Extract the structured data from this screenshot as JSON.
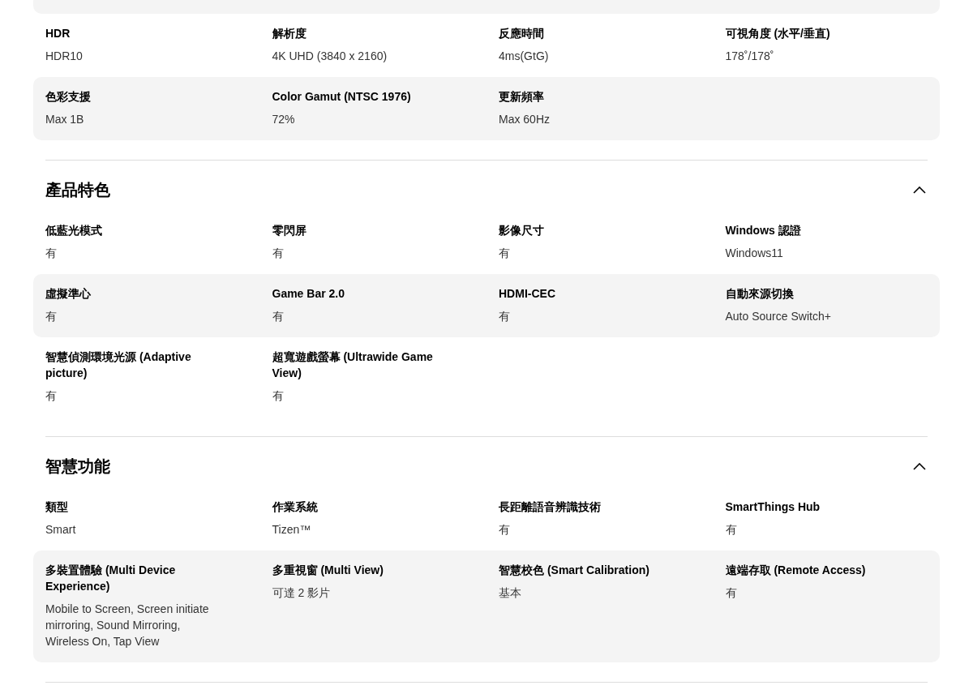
{
  "sections": [
    {
      "rows": [
        [
          {
            "label": "HDR",
            "value": "HDR10"
          },
          {
            "label": "解析度",
            "value": "4K UHD (3840 x 2160)"
          },
          {
            "label": "反應時間",
            "value": "4ms(GtG)"
          },
          {
            "label": "可視角度 (水平/垂直)",
            "value": "178˚/178˚"
          }
        ],
        [
          {
            "label": "色彩支援",
            "value": "Max 1B"
          },
          {
            "label": "Color Gamut (NTSC 1976)",
            "value": "72%"
          },
          {
            "label": "更新頻率",
            "value": "Max 60Hz"
          }
        ]
      ]
    },
    {
      "title": "產品特色",
      "expanded": true,
      "rows": [
        [
          {
            "label": "低藍光模式",
            "value": "有"
          },
          {
            "label": "零閃屏",
            "value": "有"
          },
          {
            "label": "影像尺寸",
            "value": "有"
          },
          {
            "label": "Windows 認證",
            "value": "Windows11"
          }
        ],
        [
          {
            "label": "虛擬準心",
            "value": "有"
          },
          {
            "label": "Game Bar 2.0",
            "value": "有"
          },
          {
            "label": "HDMI-CEC",
            "value": "有"
          },
          {
            "label": "自動來源切換",
            "value": "Auto Source Switch+"
          }
        ],
        [
          {
            "label": "智慧偵測環境光源 (Adaptive picture)",
            "value": "有"
          },
          {
            "label": "超寬遊戲螢幕 (Ultrawide Game View)",
            "value": "有"
          }
        ]
      ]
    },
    {
      "title": "智慧功能",
      "expanded": true,
      "rows": [
        [
          {
            "label": "類型",
            "value": "Smart"
          },
          {
            "label": "作業系統",
            "value": "Tizen™"
          },
          {
            "label": "長距離語音辨識技術",
            "value": "有"
          },
          {
            "label": "SmartThings Hub",
            "value": "有"
          }
        ],
        [
          {
            "label": "多裝置體驗 (Multi Device Experience)",
            "value": "Mobile to Screen, Screen initiate mirroring, Sound Mirroring, Wireless On, Tap View"
          },
          {
            "label": "多重視窗 (Multi View)",
            "value": "可達 2 影片"
          },
          {
            "label": "智慧校色 (Smart Calibration)",
            "value": "基本"
          },
          {
            "label": "遠端存取 (Remote Access)",
            "value": "有"
          }
        ]
      ]
    }
  ]
}
